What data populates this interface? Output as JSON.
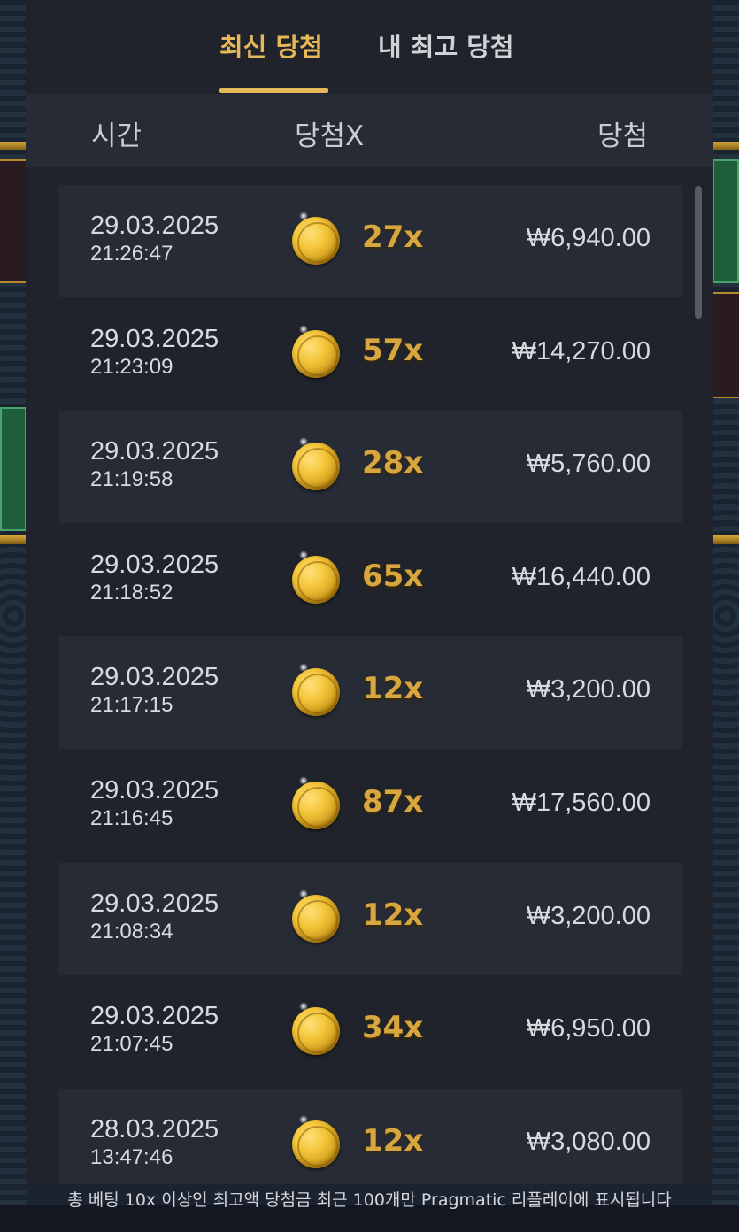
{
  "tabs": [
    {
      "label": "최신 당첨",
      "active": true
    },
    {
      "label": "내 최고 당첨",
      "active": false
    }
  ],
  "columns": {
    "time": "시간",
    "multiplier": "당첨X",
    "win": "당첨"
  },
  "rows": [
    {
      "date": "29.03.2025",
      "time": "21:26:47",
      "multiplier": "27x",
      "amount": "₩6,940.00"
    },
    {
      "date": "29.03.2025",
      "time": "21:23:09",
      "multiplier": "57x",
      "amount": "₩14,270.00"
    },
    {
      "date": "29.03.2025",
      "time": "21:19:58",
      "multiplier": "28x",
      "amount": "₩5,760.00"
    },
    {
      "date": "29.03.2025",
      "time": "21:18:52",
      "multiplier": "65x",
      "amount": "₩16,440.00"
    },
    {
      "date": "29.03.2025",
      "time": "21:17:15",
      "multiplier": "12x",
      "amount": "₩3,200.00"
    },
    {
      "date": "29.03.2025",
      "time": "21:16:45",
      "multiplier": "87x",
      "amount": "₩17,560.00"
    },
    {
      "date": "29.03.2025",
      "time": "21:08:34",
      "multiplier": "12x",
      "amount": "₩3,200.00"
    },
    {
      "date": "29.03.2025",
      "time": "21:07:45",
      "multiplier": "34x",
      "amount": "₩6,950.00"
    },
    {
      "date": "28.03.2025",
      "time": "13:47:46",
      "multiplier": "12x",
      "amount": "₩3,080.00"
    }
  ],
  "footer_note": "총 베팅 10x 이상인 최고액 당첨금 최근 100개만 Pragmatic 리플레이에 표시됩니다",
  "colors": {
    "accent": "#e6b85a",
    "multiplier": "#d7a63e",
    "panel": "#20232b",
    "row_shaded": "#272b35"
  },
  "icons": {
    "row_icon": "gold-coin-icon"
  }
}
